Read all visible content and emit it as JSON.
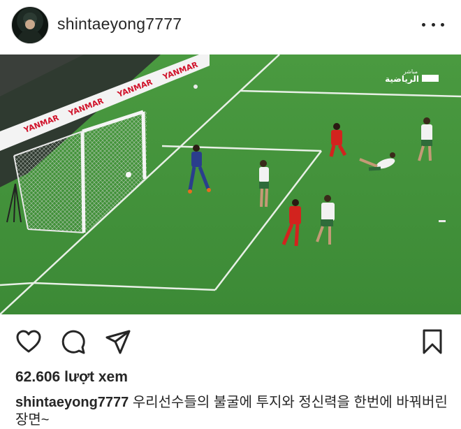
{
  "post": {
    "author": "shintaeyong7777",
    "views_text": "62.606 lượt xem",
    "caption_user": "shintaeyong7777",
    "caption_text": "우리선수들의 불굴에 투지와 정신력을 한번에 바꿔버린장면~"
  },
  "media": {
    "broadcaster_logo_text": "الرياضية",
    "broadcaster_live_text": "مباشر",
    "ad_board_text": "YANMAR",
    "colors": {
      "pitch": "#3f8f3a",
      "ad_board": "#f3f3f3",
      "ad_text": "#d0122a",
      "red_team": "#d2231e",
      "white_team": "#f2f2f2",
      "keeper": "#2a3e8c"
    }
  },
  "actions": {
    "like_icon": "heart-icon",
    "comment_icon": "comment-icon",
    "share_icon": "send-icon",
    "save_icon": "bookmark-icon"
  },
  "header": {
    "more_icon": "more-options-icon"
  }
}
